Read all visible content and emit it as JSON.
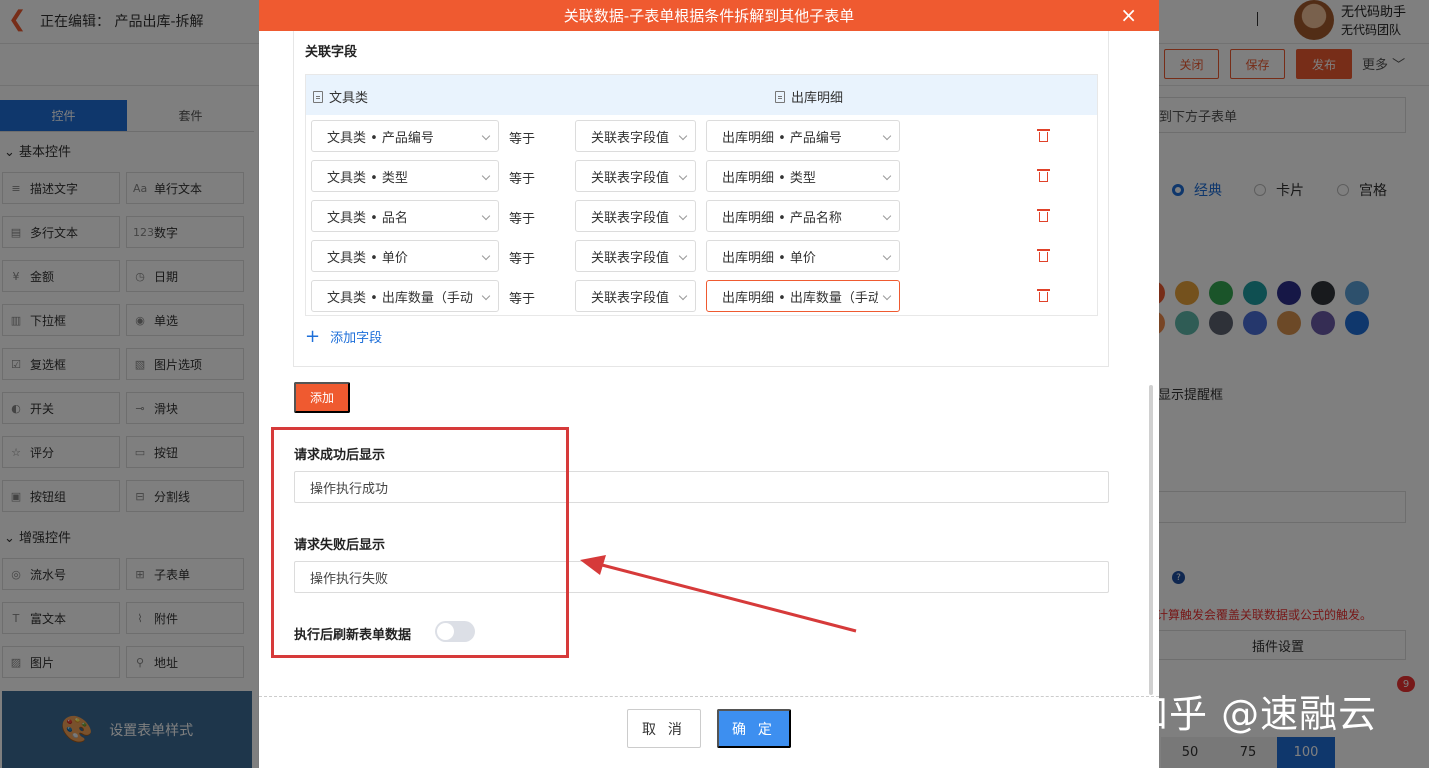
{
  "header": {
    "edit_label": "正在编辑：  产品出库-拆解",
    "user_name": "无代码助手",
    "team_name": "无代码团队"
  },
  "toolbar": {
    "close_label": "关闭",
    "save_label": "保存",
    "publish_label": "发布",
    "more_label": "更多 ﹀"
  },
  "left_panel": {
    "tabs": [
      "控件",
      "套件"
    ],
    "basic_title": "⌄ 基本控件",
    "basic_controls": [
      {
        "icon": "≡",
        "label": "描述文字"
      },
      {
        "icon": "Aa",
        "label": "单行文本"
      },
      {
        "icon": "▤",
        "label": "多行文本"
      },
      {
        "icon": "123",
        "label": "数字"
      },
      {
        "icon": "¥",
        "label": "金额"
      },
      {
        "icon": "◷",
        "label": "日期"
      },
      {
        "icon": "▥",
        "label": "下拉框"
      },
      {
        "icon": "◉",
        "label": "单选"
      },
      {
        "icon": "☑",
        "label": "复选框"
      },
      {
        "icon": "▧",
        "label": "图片选项"
      },
      {
        "icon": "◐",
        "label": "开关"
      },
      {
        "icon": "⊸",
        "label": "滑块"
      },
      {
        "icon": "☆",
        "label": "评分"
      },
      {
        "icon": "▭",
        "label": "按钮"
      },
      {
        "icon": "▣",
        "label": "按钮组"
      },
      {
        "icon": "⊟",
        "label": "分割线"
      }
    ],
    "enhanced_title": "⌄ 增强控件",
    "enhanced_controls": [
      {
        "icon": "◎",
        "label": "流水号"
      },
      {
        "icon": "⊞",
        "label": "子表单"
      },
      {
        "icon": "T",
        "label": "富文本"
      },
      {
        "icon": "⌇",
        "label": "附件"
      },
      {
        "icon": "▨",
        "label": "图片"
      },
      {
        "icon": "⚲",
        "label": "地址"
      }
    ],
    "style_button": "设置表单样式"
  },
  "right_panel": {
    "input_text": "到下方子表单",
    "layout_options": [
      "经典",
      "卡片",
      "宫格"
    ],
    "colors": [
      "#ef5a30",
      "#e9a23b",
      "#34a853",
      "#1f9ea3",
      "#2c2f8c",
      "#30343b",
      "#5aa0d8",
      "#f08a4b",
      "#5eb8aa",
      "#5c6270",
      "#4b6fd8",
      "#d8924e",
      "#6a5aa8",
      "#1e6fd9"
    ],
    "tip_text": "显示提醒框",
    "help_icon": "?",
    "warning_text": "计算触发会覆盖关联数据或公式的触发。",
    "plugin_button": "插件设置",
    "badge": "9",
    "zoom_options": [
      "50",
      "75",
      "100"
    ]
  },
  "watermark": "知乎 @速融云",
  "modal": {
    "title": "关联数据-子表单根据条件拆解到其他子表单",
    "close_icon": "×",
    "section_title": "关联字段",
    "col_left": "文具类",
    "col_right": "出库明细",
    "rows": [
      {
        "left": "文具类 • 产品编号",
        "op": "等于",
        "mode": "关联表字段值",
        "right": "出库明细 • 产品编号"
      },
      {
        "left": "文具类 • 类型",
        "op": "等于",
        "mode": "关联表字段值",
        "right": "出库明细 • 类型"
      },
      {
        "left": "文具类 • 品名",
        "op": "等于",
        "mode": "关联表字段值",
        "right": "出库明细 • 产品名称"
      },
      {
        "left": "文具类 • 单价",
        "op": "等于",
        "mode": "关联表字段值",
        "right": "出库明细 • 单价"
      },
      {
        "left": "文具类 • 出库数量（手动",
        "op": "等于",
        "mode": "关联表字段值",
        "right": "出库明细 • 出库数量（手动"
      }
    ],
    "add_field_label": "添加字段",
    "add_button": "添加",
    "success_label": "请求成功后显示",
    "success_value": "操作执行成功",
    "fail_label": "请求失败后显示",
    "fail_value": "操作执行失败",
    "refresh_label": "执行后刷新表单数据",
    "refresh_on": false,
    "cancel_button": "取 消",
    "ok_button": "确 定"
  }
}
